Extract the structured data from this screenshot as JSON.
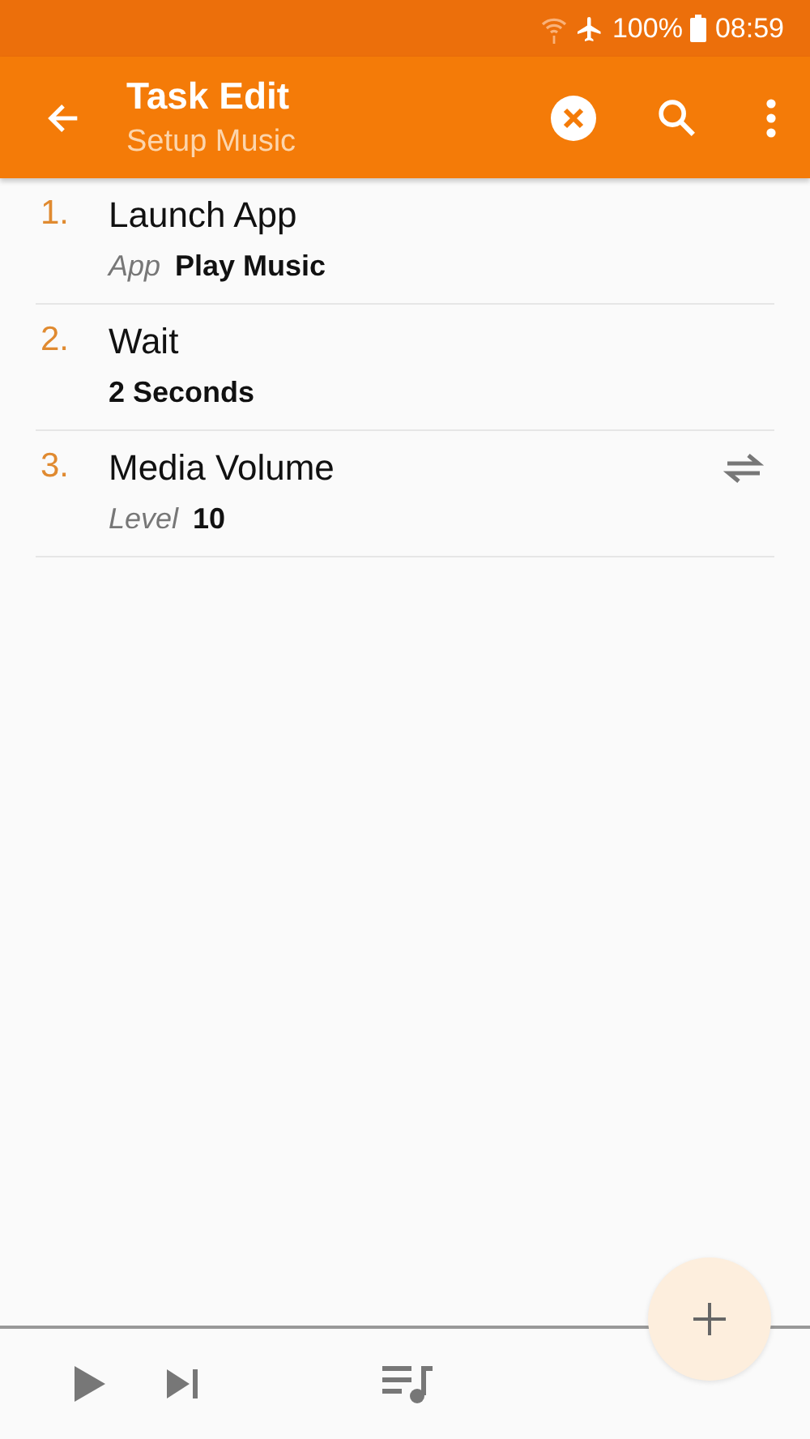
{
  "status_bar": {
    "battery": "100%",
    "time": "08:59"
  },
  "toolbar": {
    "title": "Task Edit",
    "subtitle": "Setup Music"
  },
  "actions": [
    {
      "number": "1.",
      "name": "Launch App",
      "param_label": "App",
      "value": "Play Music",
      "kind": "plain"
    },
    {
      "number": "2.",
      "name": "Wait",
      "value": "2 Seconds",
      "kind": "plain"
    },
    {
      "number": "3.",
      "name": "Media Volume",
      "param_label": "Level",
      "value": "10",
      "kind": "switchable"
    }
  ]
}
